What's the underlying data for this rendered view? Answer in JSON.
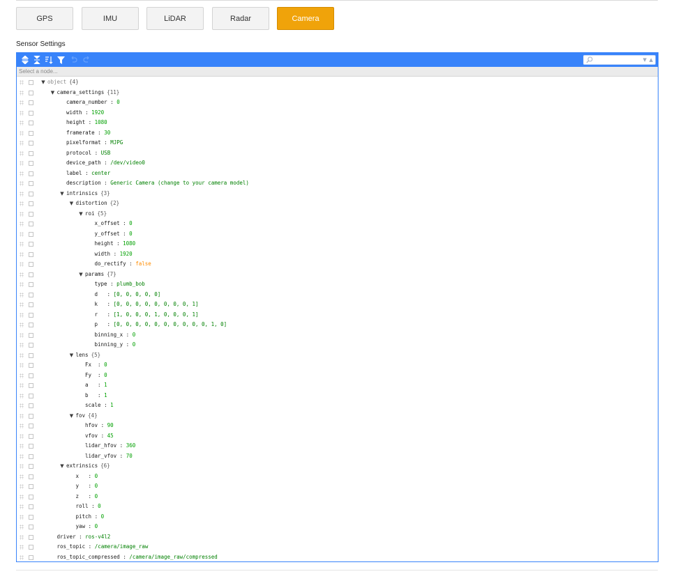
{
  "tabs": [
    {
      "label": "GPS",
      "active": false
    },
    {
      "label": "IMU",
      "active": false
    },
    {
      "label": "LiDAR",
      "active": false
    },
    {
      "label": "Radar",
      "active": false
    },
    {
      "label": "Camera",
      "active": true
    }
  ],
  "section_title": "Sensor Settings",
  "editor": {
    "navbar_placeholder": "Select a node...",
    "search_value": "",
    "menu_icons": [
      "expand-all-icon",
      "collapse-all-icon",
      "sort-icon",
      "filter-icon",
      "undo-icon",
      "redo-icon"
    ],
    "accent_color": "#3883fa"
  },
  "tree": [
    {
      "level": 0,
      "key": "object",
      "type": "object",
      "count": "{4}",
      "root": true
    },
    {
      "level": 1,
      "key": "camera_settings",
      "type": "object",
      "count": "{11}"
    },
    {
      "level": 2,
      "key": "camera_number",
      "value": "0",
      "vtype": "num"
    },
    {
      "level": 2,
      "key": "width",
      "value": "1920",
      "vtype": "num"
    },
    {
      "level": 2,
      "key": "height",
      "value": "1080",
      "vtype": "num"
    },
    {
      "level": 2,
      "key": "framerate",
      "value": "30",
      "vtype": "num"
    },
    {
      "level": 2,
      "key": "pixelformat",
      "value": "MJPG",
      "vtype": "str"
    },
    {
      "level": 2,
      "key": "protocol",
      "value": "USB",
      "vtype": "str"
    },
    {
      "level": 2,
      "key": "device_path",
      "value": "/dev/video0",
      "vtype": "str"
    },
    {
      "level": 2,
      "key": "label",
      "value": "center",
      "vtype": "str"
    },
    {
      "level": 2,
      "key": "description",
      "value": "Generic Camera (change to your camera model)",
      "vtype": "str"
    },
    {
      "level": 2,
      "key": "intrinsics",
      "type": "object",
      "count": "{3}"
    },
    {
      "level": 3,
      "key": "distortion",
      "type": "object",
      "count": "{2}"
    },
    {
      "level": 4,
      "key": "roi",
      "type": "object",
      "count": "{5}"
    },
    {
      "level": 5,
      "key": "x_offset",
      "value": "0",
      "vtype": "num"
    },
    {
      "level": 5,
      "key": "y_offset",
      "value": "0",
      "vtype": "num"
    },
    {
      "level": 5,
      "key": "height",
      "value": "1080",
      "vtype": "num"
    },
    {
      "level": 5,
      "key": "width",
      "value": "1920",
      "vtype": "num"
    },
    {
      "level": 5,
      "key": "do_rectify",
      "value": "false",
      "vtype": "bool"
    },
    {
      "level": 4,
      "key": "params",
      "type": "object",
      "count": "{7}"
    },
    {
      "level": 5,
      "key": "type",
      "value": "plumb_bob",
      "vtype": "str"
    },
    {
      "level": 5,
      "key": "d",
      "keypad": "d  ",
      "value": "[0, 0, 0, 0, 0]",
      "vtype": "arr"
    },
    {
      "level": 5,
      "key": "k",
      "keypad": "k  ",
      "value": "[0, 0, 0, 0, 0, 0, 0, 0, 1]",
      "vtype": "arr"
    },
    {
      "level": 5,
      "key": "r",
      "keypad": "r  ",
      "value": "[1, 0, 0, 0, 1, 0, 0, 0, 1]",
      "vtype": "arr"
    },
    {
      "level": 5,
      "key": "p",
      "keypad": "p  ",
      "value": "[0, 0, 0, 0, 0, 0, 0, 0, 0, 0, 1, 0]",
      "vtype": "arr"
    },
    {
      "level": 5,
      "key": "binning_x",
      "value": "0",
      "vtype": "num"
    },
    {
      "level": 5,
      "key": "binning_y",
      "value": "0",
      "vtype": "num"
    },
    {
      "level": 3,
      "key": "lens",
      "type": "object",
      "count": "{5}"
    },
    {
      "level": 4,
      "key": "Fx",
      "keypad": "Fx ",
      "value": "0",
      "vtype": "num"
    },
    {
      "level": 4,
      "key": "Fy",
      "keypad": "Fy ",
      "value": "0",
      "vtype": "num"
    },
    {
      "level": 4,
      "key": "a",
      "keypad": "a  ",
      "value": "1",
      "vtype": "num"
    },
    {
      "level": 4,
      "key": "b",
      "keypad": "b  ",
      "value": "1",
      "vtype": "num"
    },
    {
      "level": 4,
      "key": "scale",
      "value": "1",
      "vtype": "num"
    },
    {
      "level": 3,
      "key": "fov",
      "type": "object",
      "count": "{4}"
    },
    {
      "level": 4,
      "key": "hfov",
      "value": "90",
      "vtype": "num"
    },
    {
      "level": 4,
      "key": "vfov",
      "value": "45",
      "vtype": "num"
    },
    {
      "level": 4,
      "key": "lidar_hfov",
      "value": "360",
      "vtype": "num"
    },
    {
      "level": 4,
      "key": "lidar_vfov",
      "value": "70",
      "vtype": "num"
    },
    {
      "level": 2,
      "key": "extrinsics",
      "type": "object",
      "count": "{6}"
    },
    {
      "level": 3,
      "key": "x",
      "keypad": "x  ",
      "value": "0",
      "vtype": "num"
    },
    {
      "level": 3,
      "key": "y",
      "keypad": "y  ",
      "value": "0",
      "vtype": "num"
    },
    {
      "level": 3,
      "key": "z",
      "keypad": "z  ",
      "value": "0",
      "vtype": "num"
    },
    {
      "level": 3,
      "key": "roll",
      "value": "0",
      "vtype": "num"
    },
    {
      "level": 3,
      "key": "pitch",
      "value": "0",
      "vtype": "num"
    },
    {
      "level": 3,
      "key": "yaw",
      "value": "0",
      "vtype": "num"
    },
    {
      "level": 1,
      "key": "driver",
      "value": "ros-v4l2",
      "vtype": "str"
    },
    {
      "level": 1,
      "key": "ros_topic",
      "value": "/camera/image_raw",
      "vtype": "str"
    },
    {
      "level": 1,
      "key": "ros_topic_compressed",
      "value": "/camera/image_raw/compressed",
      "vtype": "str"
    }
  ]
}
